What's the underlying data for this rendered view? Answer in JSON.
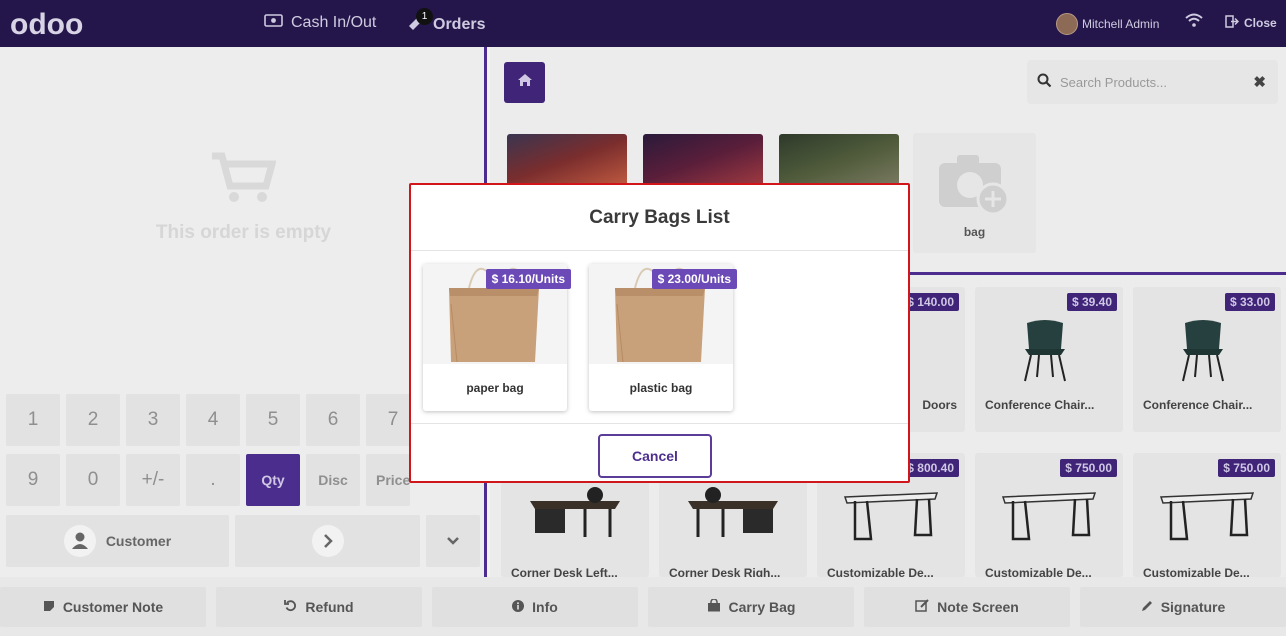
{
  "topbar": {
    "logo": "odoo",
    "cash_label": "Cash In/Out",
    "orders_label": "Orders",
    "orders_count": "1",
    "user_name": "Mitchell Admin",
    "close_label": "Close"
  },
  "order": {
    "empty_text": "This order is empty"
  },
  "numpad": {
    "row1": [
      "1",
      "2",
      "3",
      "4",
      "5",
      "6",
      "7"
    ],
    "row2": [
      "9",
      "0",
      "+/-",
      "."
    ],
    "qty": "Qty",
    "disc": "Disc",
    "price": "Price",
    "customer": "Customer"
  },
  "search": {
    "placeholder": "Search Products..."
  },
  "categories": {
    "bag_label": "bag"
  },
  "products": [
    {
      "name": "Doors",
      "price": "$ 140.00"
    },
    {
      "name": "Conference Chair...",
      "price": "$ 39.40"
    },
    {
      "name": "Conference Chair...",
      "price": "$ 33.00"
    },
    {
      "name": "Corner Desk Left...",
      "price": ""
    },
    {
      "name": "Corner Desk Righ...",
      "price": ""
    },
    {
      "name": "Customizable De...",
      "price": "$ 800.40"
    },
    {
      "name": "Customizable De...",
      "price": "$ 750.00"
    },
    {
      "name": "Customizable De...",
      "price": "$ 750.00"
    }
  ],
  "bottom": {
    "customer_note": "Customer Note",
    "refund": "Refund",
    "info": "Info",
    "carry_bag": "Carry Bag",
    "note_screen": "Note Screen",
    "signature": "Signature"
  },
  "modal": {
    "title": "Carry Bags List",
    "bags": [
      {
        "name": "paper bag",
        "price": "$ 16.10/Units"
      },
      {
        "name": "plastic bag",
        "price": "$ 23.00/Units"
      }
    ],
    "cancel": "Cancel"
  },
  "colors": {
    "brand": "#24164b",
    "accent": "#6b49b6",
    "modal_border": "#d0161b"
  }
}
